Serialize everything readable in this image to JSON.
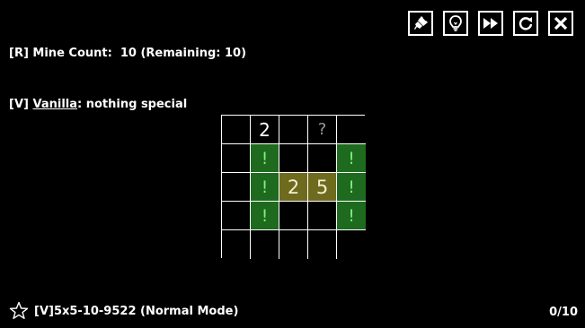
{
  "info": {
    "rule_line": "[R] Mine Count:  10 (Remaining: 10)",
    "vanilla_prefix": "[V] ",
    "vanilla_name": "Vanilla",
    "vanilla_suffix": ": nothing special"
  },
  "toolbar": {
    "buttons": [
      {
        "name": "brush-button",
        "icon": "brush-icon"
      },
      {
        "name": "hint-button",
        "icon": "lightbulb-icon"
      },
      {
        "name": "skip-button",
        "icon": "fast-forward-icon"
      },
      {
        "name": "restart-button",
        "icon": "refresh-icon"
      },
      {
        "name": "close-button",
        "icon": "close-icon"
      }
    ]
  },
  "board": {
    "rows": 5,
    "cols": 5,
    "cells": [
      [
        "",
        "2",
        "",
        "?",
        ""
      ],
      [
        "",
        "!",
        "",
        "",
        "!"
      ],
      [
        "",
        "!",
        "2",
        "5",
        "!"
      ],
      [
        "",
        "!",
        "",
        "",
        "!"
      ],
      [
        "",
        "",
        "",
        "",
        ""
      ]
    ],
    "cell_types": [
      [
        "empty",
        "number",
        "empty",
        "unknown",
        "empty"
      ],
      [
        "empty",
        "flag",
        "empty",
        "empty",
        "flag"
      ],
      [
        "empty",
        "flag",
        "highlight",
        "highlight",
        "flag"
      ],
      [
        "empty",
        "flag",
        "empty",
        "empty",
        "flag"
      ],
      [
        "empty",
        "empty",
        "empty",
        "empty",
        "empty"
      ]
    ]
  },
  "footer": {
    "star_icon": "star-icon",
    "puzzle_id": "[V]5x5-10-9522 (Normal Mode)",
    "progress": "0/10"
  },
  "colors": {
    "background": "#000000",
    "flag_cell": "#1e6a1e",
    "flag_text": "#7cf07c",
    "highlight_cell": "#6e6a1e"
  }
}
